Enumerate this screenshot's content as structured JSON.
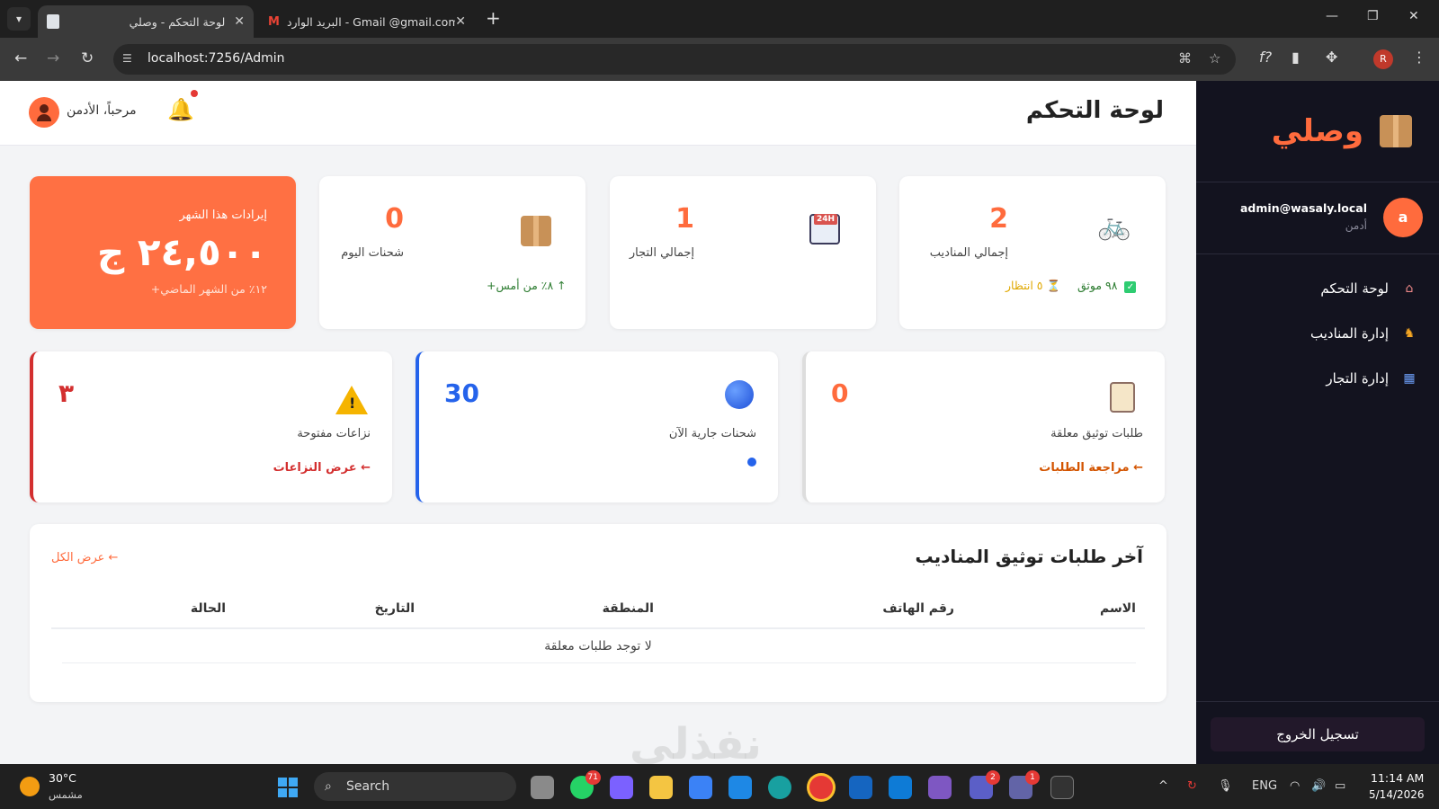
{
  "browser": {
    "tabs": [
      {
        "title": "لوحة التحكم - وصلي",
        "active": true
      },
      {
        "title": "البريد الوارد - Gmail @gmail.com",
        "active": false
      }
    ],
    "url": "localhost:7256/Admin",
    "profile_initial": "R"
  },
  "sidebar": {
    "brand": "وصلي",
    "user": {
      "email": "admin@wasaly.local",
      "role": "أدمن",
      "initial": "a"
    },
    "menu": [
      {
        "label": "لوحة التحكم",
        "icon": "house-icon"
      },
      {
        "label": "إدارة المناديب",
        "icon": "runner-icon"
      },
      {
        "label": "إدارة التجار",
        "icon": "store-icon"
      }
    ],
    "logout": "تسجيل الخروج"
  },
  "header": {
    "title": "لوحة التحكم",
    "welcome": "مرحباً، الأدمن"
  },
  "stats": {
    "revenue": {
      "label": "إيرادات هذا الشهر",
      "value": "٢٤,٥٠٠ ج",
      "sub": "+١٢٪ من الشهر الماضي"
    },
    "today_shipments": {
      "value": "0",
      "label": "شحنات اليوم",
      "sub": "+٨٪ من أمس ↑"
    },
    "merchants": {
      "value": "1",
      "label": "إجمالي التجار"
    },
    "couriers": {
      "value": "2",
      "label": "إجمالي المناديب",
      "verified": "٩٨ موثق",
      "pending": "٥ انتظار"
    }
  },
  "wide_cards": {
    "disputes": {
      "value": "٣",
      "label": "نزاعات مفتوحة",
      "link": "عرض النزاعات ←"
    },
    "in_progress": {
      "value": "30",
      "label": "شحنات جارية الآن"
    },
    "pending_verification": {
      "value": "0",
      "label": "طلبات توثيق معلقة",
      "link": "مراجعة الطلبات ←"
    }
  },
  "table": {
    "title": "آخر طلبات توثيق المناديب",
    "view_all": "عرض الكل ←",
    "columns": [
      "الاسم",
      "رقم الهاتف",
      "المنطقة",
      "التاريخ",
      "الحالة"
    ],
    "empty": "لا توجد طلبات معلقة"
  },
  "watermark": "نفذلي",
  "taskbar": {
    "weather_temp": "30°C",
    "weather_desc": "مشمس",
    "search": "Search",
    "lang": "ENG",
    "time": "11:14 AM",
    "date": "5/14/2026",
    "badges": {
      "whatsapp": "71",
      "teams1": "2",
      "teams2": "1"
    }
  },
  "colors": {
    "accent": "#ff6b3d",
    "sidebar": "#13131f",
    "blue": "#2563eb",
    "red": "#d32f2f"
  }
}
